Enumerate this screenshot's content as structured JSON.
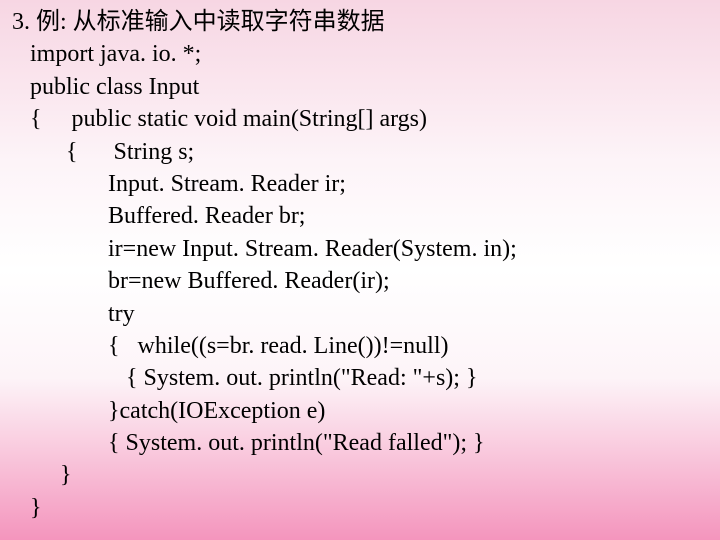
{
  "lines": [
    " 3. 例: 从标准输入中读取字符串数据",
    "    import java. io. *;",
    "    public class Input",
    "    {     public static void main(String[] args)",
    "          {      String s;",
    "                 Input. Stream. Reader ir;",
    "                 Buffered. Reader br;",
    "                 ir=new Input. Stream. Reader(System. in);",
    "                 br=new Buffered. Reader(ir);",
    "                 try",
    "                 {   while((s=br. read. Line())!=null)",
    "                    { System. out. println(\"Read: \"+s); }",
    "                 }catch(IOException e)",
    "                 { System. out. println(\"Read falled\"); }",
    "         }",
    "    }"
  ]
}
